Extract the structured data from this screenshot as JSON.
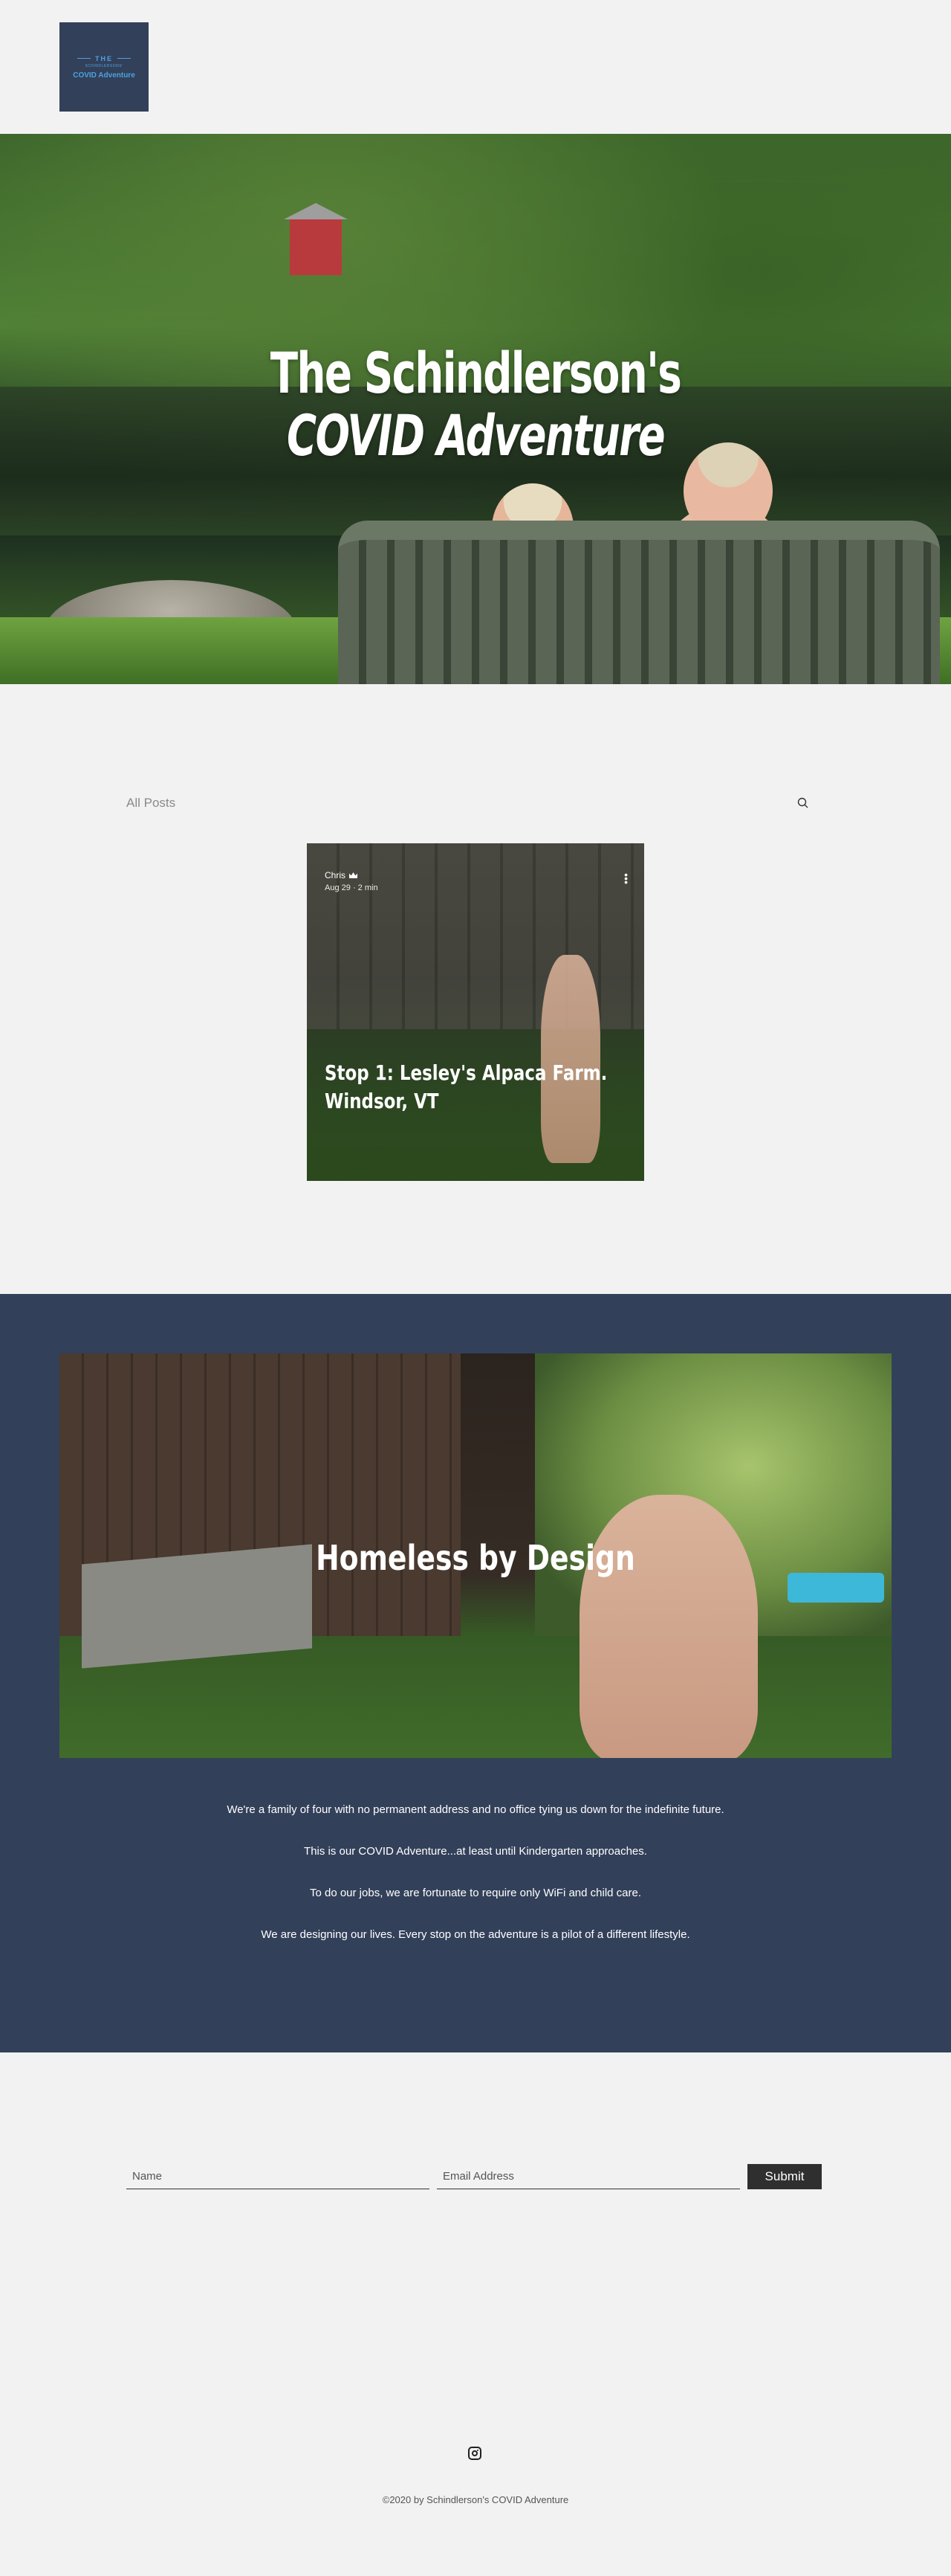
{
  "header": {
    "logo": {
      "line1": "THE",
      "line2": "SCHINDLERSONS'",
      "line3": "COVID Adventure"
    }
  },
  "hero": {
    "title_line1": "The Schindlerson's",
    "title_line2": "COVID Adventure"
  },
  "blog": {
    "filter_label": "All Posts",
    "search_icon": "search-icon",
    "post": {
      "author": "Chris",
      "date": "Aug 29",
      "read_time": "2 min",
      "title": "Stop 1: Lesley's Alpaca Farm. Windsor, VT"
    }
  },
  "about": {
    "title": "Homeless by Design",
    "paragraphs": [
      "We're a family of four with no permanent address and no office tying us down for the indefinite future.",
      "This is our COVID Adventure...at least until Kindergarten approaches.",
      "To do our jobs, we are fortunate to require only WiFi and child care.",
      "We are designing our lives. Every stop on the adventure is a pilot of a different lifestyle."
    ]
  },
  "subscribe": {
    "name_placeholder": "Name",
    "email_placeholder": "Email Address",
    "submit_label": "Submit"
  },
  "footer": {
    "social_icon": "instagram-icon",
    "copyright": "©2020 by Schindlerson's COVID Adventure"
  },
  "colors": {
    "background": "#f2f2f2",
    "navy": "#33405a",
    "logo_accent": "#4aa3df",
    "button": "#2f2f2f"
  }
}
